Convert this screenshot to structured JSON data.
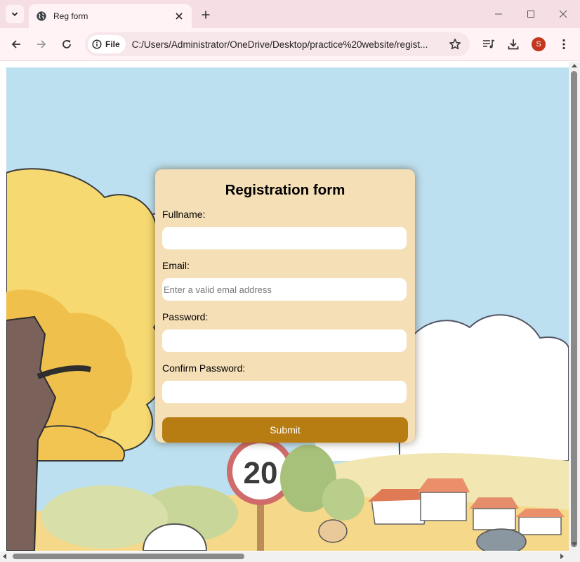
{
  "browser": {
    "tab_title": "Reg form",
    "site_chip_label": "File",
    "url": "C:/Users/Administrator/OneDrive/Desktop/practice%20website/regist...",
    "profile_initial": "S",
    "icons": [
      "tab-search-icon",
      "globe-icon",
      "close-icon",
      "plus-icon",
      "minimize-icon",
      "maximize-icon",
      "window-close-icon",
      "back-arrow-icon",
      "forward-arrow-icon",
      "reload-icon",
      "info-icon",
      "star-icon",
      "media-queue-icon",
      "download-icon",
      "kebab-menu-icon"
    ]
  },
  "form": {
    "title": "Registration form",
    "fullname_label": "Fullname:",
    "email_label": "Email:",
    "email_placeholder": "Enter a valid emal address",
    "password_label": "Password:",
    "confirm_label": "Confirm Password:",
    "submit_label": "Submit"
  },
  "colors": {
    "card": "#f5dfb7",
    "button": "#b77c12",
    "sky": "#bde0f0",
    "tabbar": "#f6dfe4"
  }
}
